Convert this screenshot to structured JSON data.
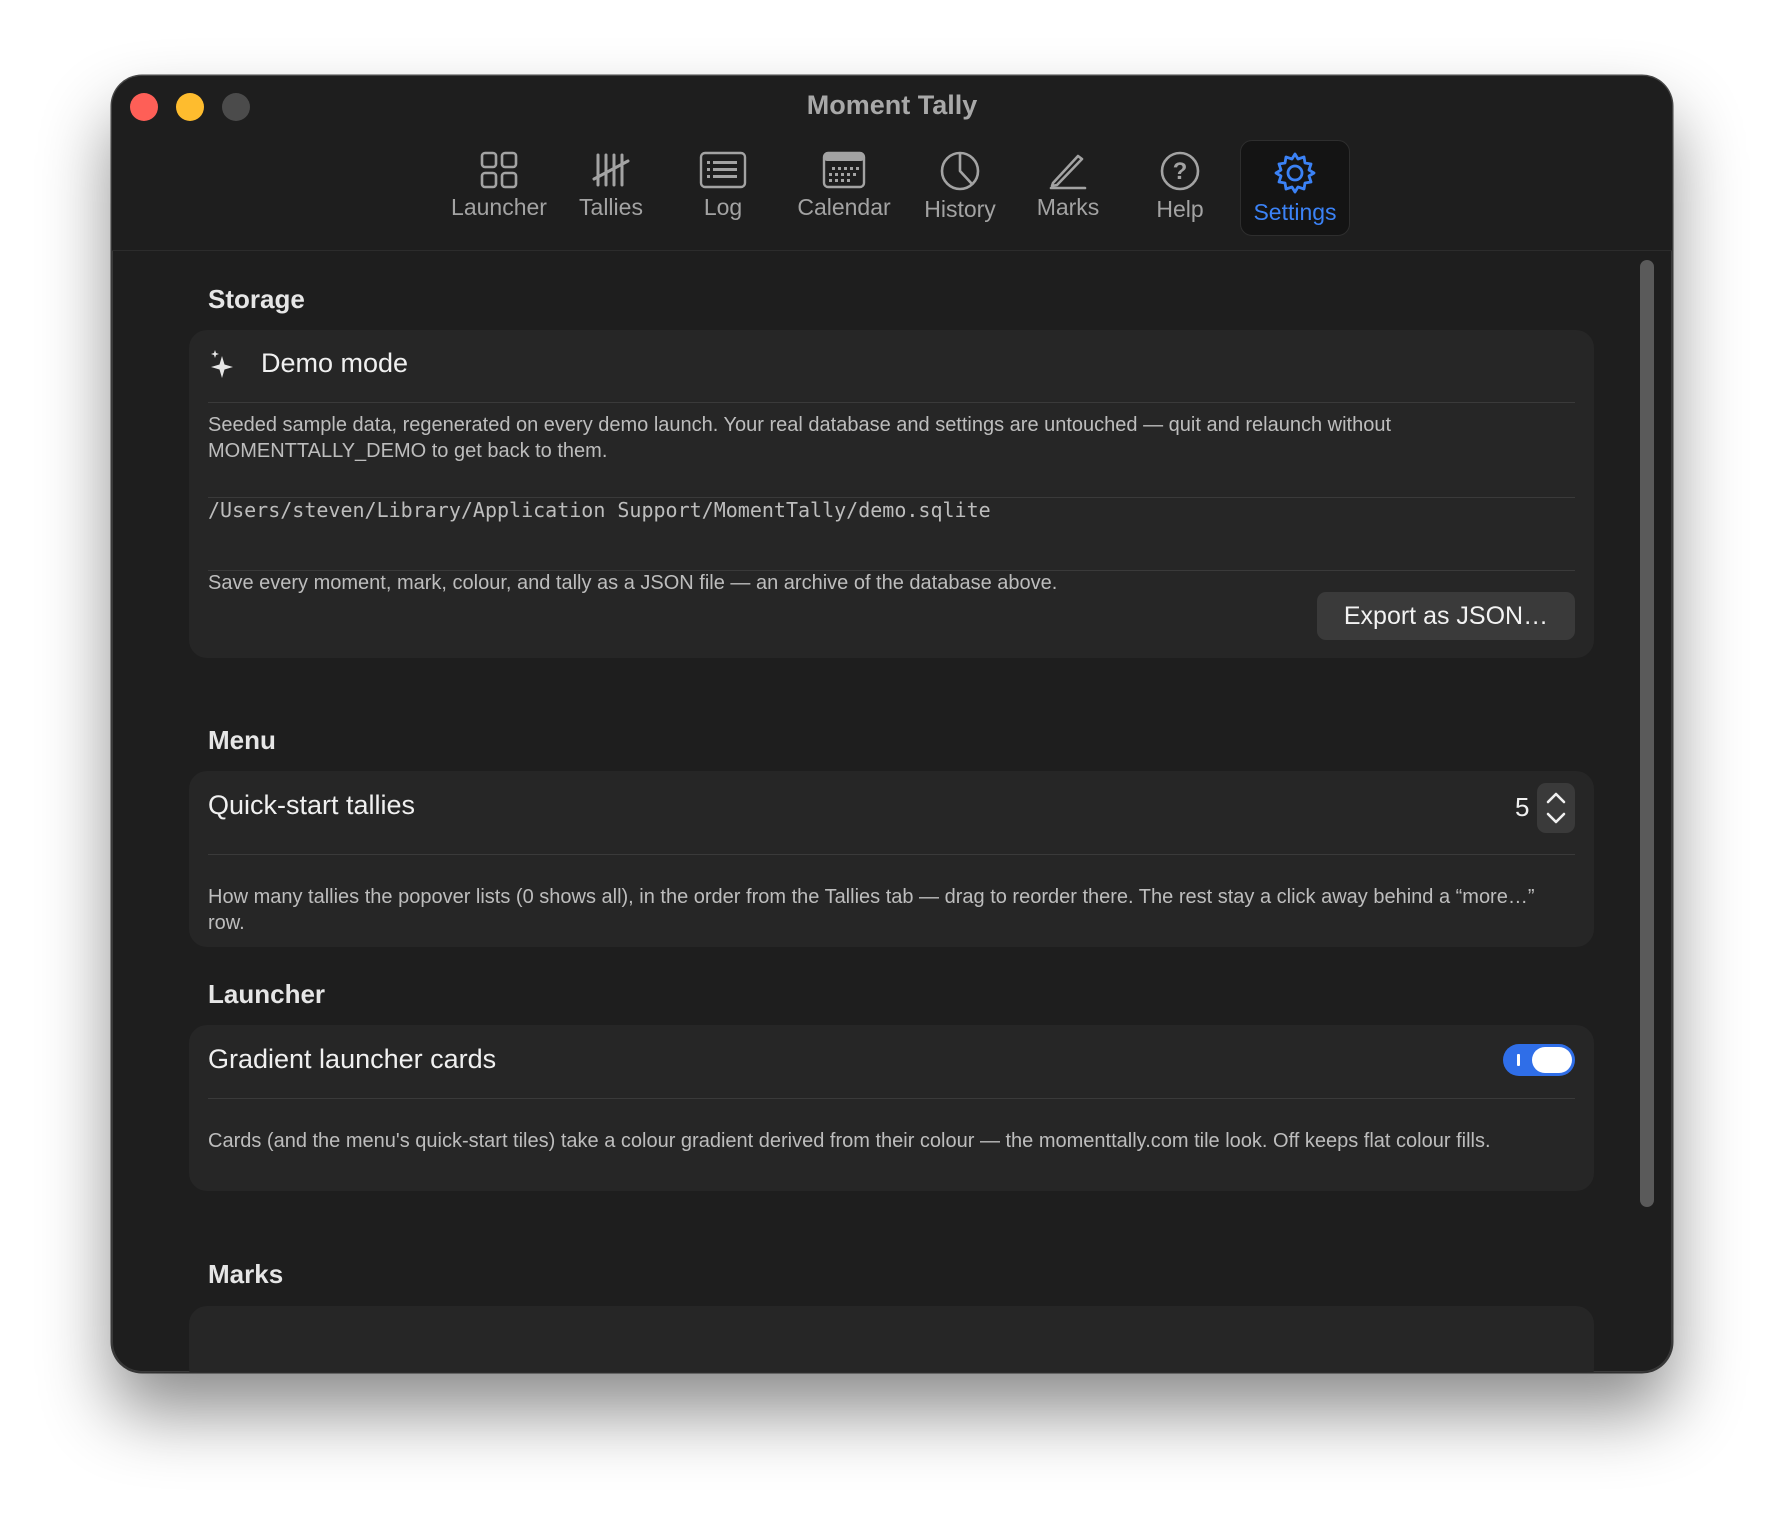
{
  "window": {
    "title": "Moment Tally"
  },
  "toolbar": {
    "tabs": [
      {
        "label": "Launcher",
        "icon": "grid-icon"
      },
      {
        "label": "Tallies",
        "icon": "tally-marks-icon"
      },
      {
        "label": "Log",
        "icon": "list-icon"
      },
      {
        "label": "Calendar",
        "icon": "calendar-icon"
      },
      {
        "label": "History",
        "icon": "pie-chart-icon"
      },
      {
        "label": "Marks",
        "icon": "pencil-icon"
      },
      {
        "label": "Help",
        "icon": "question-icon"
      },
      {
        "label": "Settings",
        "icon": "gear-icon",
        "active": true
      }
    ],
    "accent": "#3b82f6"
  },
  "storage": {
    "section_title": "Storage",
    "demo_mode_label": "Demo mode",
    "demo_description": "Seeded sample data, regenerated on every demo launch. Your real database and settings are untouched — quit and relaunch without MOMENTTALLY_DEMO to get back to them.",
    "path": "/Users/steven/Library/Application Support/MomentTally/demo.sqlite",
    "export_description": "Save every moment, mark, colour, and tally as a JSON file — an archive of the database above.",
    "export_button": "Export as JSON…"
  },
  "menu": {
    "section_title": "Menu",
    "quick_start_label": "Quick-start tallies",
    "quick_start_value": "5",
    "quick_start_description": "How many tallies the popover lists (0 shows all), in the order from the Tallies tab — drag to reorder there. The rest stay a click away behind a “more…” row."
  },
  "launcher": {
    "section_title": "Launcher",
    "gradient_label": "Gradient launcher cards",
    "gradient_enabled": true,
    "gradient_description": "Cards (and the menu's quick-start tiles) take a colour gradient derived from their colour — the momenttally.com tile look. Off keeps flat colour fills."
  },
  "marks": {
    "section_title": "Marks"
  }
}
